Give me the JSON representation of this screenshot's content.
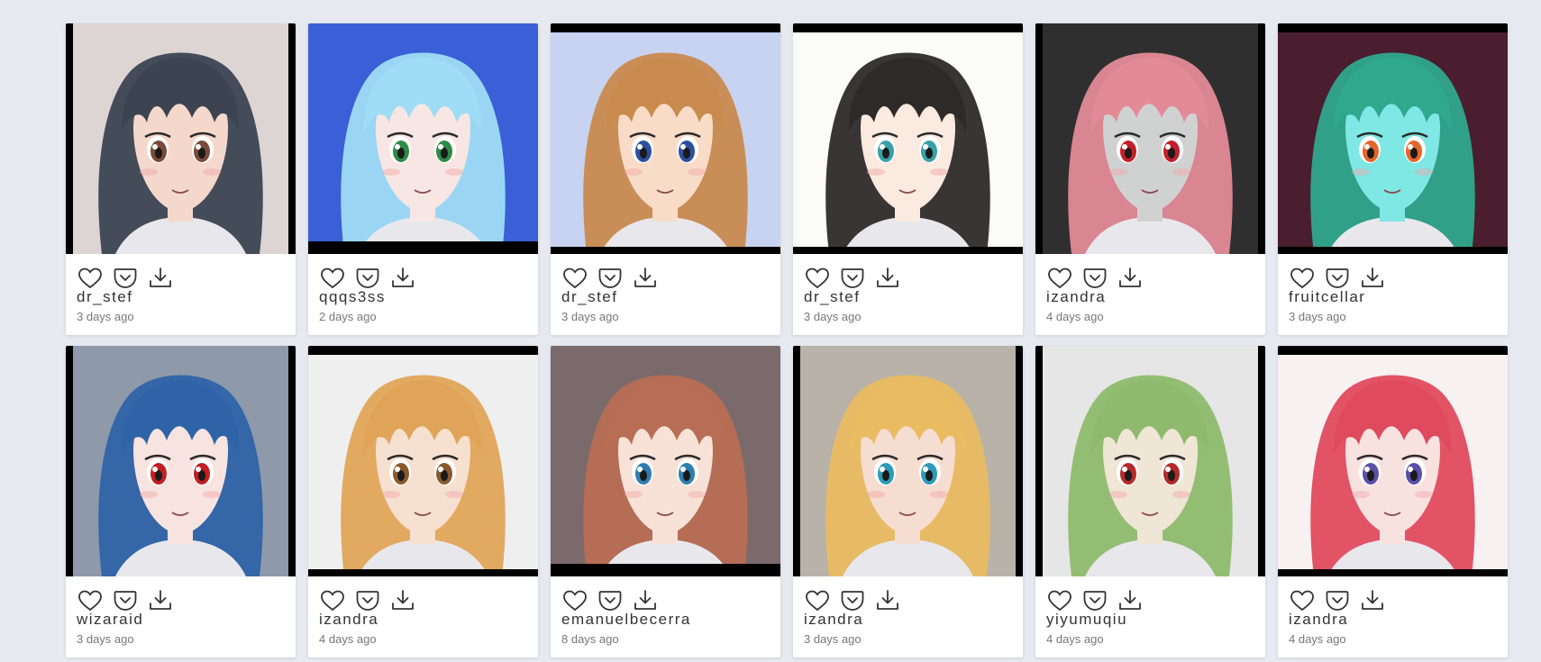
{
  "gallery": {
    "cards": [
      {
        "user": "dr_stef",
        "time": "3 days ago",
        "bg": "#ddd5d4",
        "hair": "#3c4452",
        "frame": "right",
        "skin": "#f5d8cc",
        "eyes": "#7a4a3a"
      },
      {
        "user": "qqqs3ss",
        "time": "2 days ago",
        "bg": "#3a5fd6",
        "hair": "#9fdcf5",
        "frame": "bottom",
        "skin": "#f8e6e4",
        "eyes": "#2f8a48"
      },
      {
        "user": "dr_stef",
        "time": "3 days ago",
        "bg": "#c7d3f0",
        "hair": "#c98a4e",
        "frame": "top-bottom",
        "skin": "#f9dcc8",
        "eyes": "#2e4f9e"
      },
      {
        "user": "dr_stef",
        "time": "3 days ago",
        "bg": "#fbfbf8",
        "hair": "#2e2a2a",
        "frame": "top-bottom",
        "skin": "#faeadf",
        "eyes": "#3aa0a8"
      },
      {
        "user": "izandra",
        "time": "4 days ago",
        "bg": "#2f2f2f",
        "hair": "#e38a98",
        "frame": "sides",
        "skin": "#cfd2d0",
        "eyes": "#c41e2a"
      },
      {
        "user": "fruitcellar",
        "time": "3 days ago",
        "bg": "#4a1e2e",
        "hair": "#2fa88e",
        "frame": "top-bottom",
        "skin": "#7fe7e4",
        "eyes": "#e6652a"
      },
      {
        "user": "wizaraid",
        "time": "3 days ago",
        "bg": "#8e99aa",
        "hair": "#2f63a8",
        "frame": "sides",
        "skin": "#f7e3e0",
        "eyes": "#c41e22"
      },
      {
        "user": "izandra",
        "time": "4 days ago",
        "bg": "#efefef",
        "hair": "#e0a458",
        "frame": "top-bottom",
        "skin": "#f6e0cf",
        "eyes": "#8a5a2c"
      },
      {
        "user": "emanuelbecerra",
        "time": "8 days ago",
        "bg": "#7a6a6c",
        "hair": "#b86e54",
        "frame": "bottom",
        "skin": "#f8e2d8",
        "eyes": "#2e7fb0"
      },
      {
        "user": "izandra",
        "time": "3 days ago",
        "bg": "#b8b2a8",
        "hair": "#e9bc62",
        "frame": "sides",
        "skin": "#f6ddd2",
        "eyes": "#2e9ab8"
      },
      {
        "user": "yiyumuqiu",
        "time": "4 days ago",
        "bg": "#e6e6e6",
        "hair": "#8fba6e",
        "frame": "sides",
        "skin": "#efe6d6",
        "eyes": "#b42a2a"
      },
      {
        "user": "izandra",
        "time": "4 days ago",
        "bg": "#f7f1f2",
        "hair": "#e04a5e",
        "frame": "top-bottom",
        "skin": "#f8e2e0",
        "eyes": "#5a50a8"
      }
    ]
  },
  "icons": {
    "like": "heart-icon",
    "save": "pocket-icon",
    "download": "download-icon"
  },
  "colors": {
    "page_bg": "#e6eaf0",
    "card_bg": "#ffffff",
    "username": "#333333",
    "timestamp": "#777777"
  }
}
